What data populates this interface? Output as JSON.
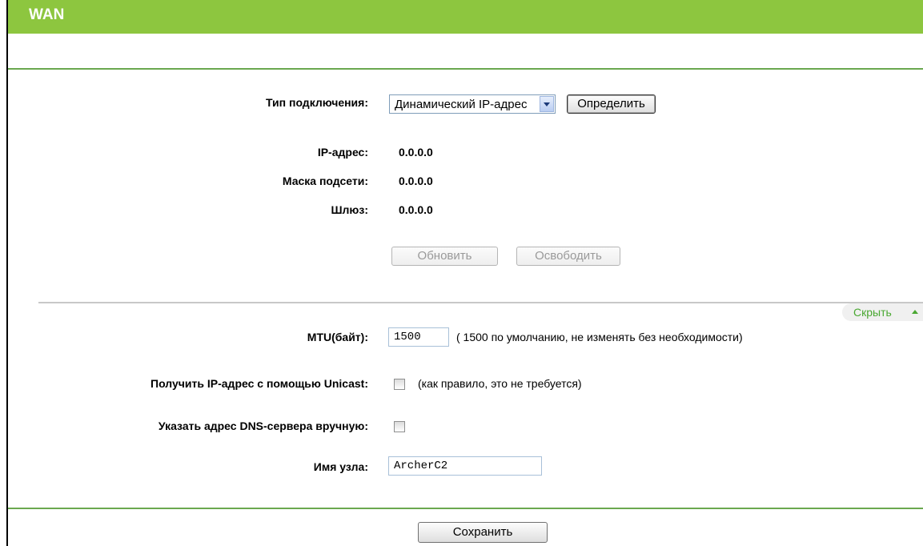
{
  "header": {
    "title": "WAN"
  },
  "connection": {
    "type_label": "Тип подключения:",
    "type_value": "Динамический IP-адрес",
    "detect_button": "Определить"
  },
  "status": {
    "ip_label": "IP-адрес:",
    "ip_value": "0.0.0.0",
    "mask_label": "Маска подсети:",
    "mask_value": "0.0.0.0",
    "gateway_label": "Шлюз:",
    "gateway_value": "0.0.0.0",
    "renew_button": "Обновить",
    "release_button": "Освободить"
  },
  "advanced": {
    "hide_label": "Скрыть",
    "mtu_label": "MTU(байт):",
    "mtu_value": "1500",
    "mtu_hint": "( 1500 по умолчанию, не изменять без необходимости)",
    "unicast_label": "Получить IP-адрес с помощью Unicast:",
    "unicast_checked": false,
    "unicast_hint": "(как правило, это не требуется)",
    "dns_label": "Указать адрес DNS-сервера вручную:",
    "dns_checked": false,
    "hostname_label": "Имя узла:",
    "hostname_value": "ArcherC2"
  },
  "footer": {
    "save_button": "Сохранить"
  },
  "colors": {
    "header_green": "#8dc63f",
    "link_green": "#4aa832",
    "divider_green": "#6aa84f"
  }
}
